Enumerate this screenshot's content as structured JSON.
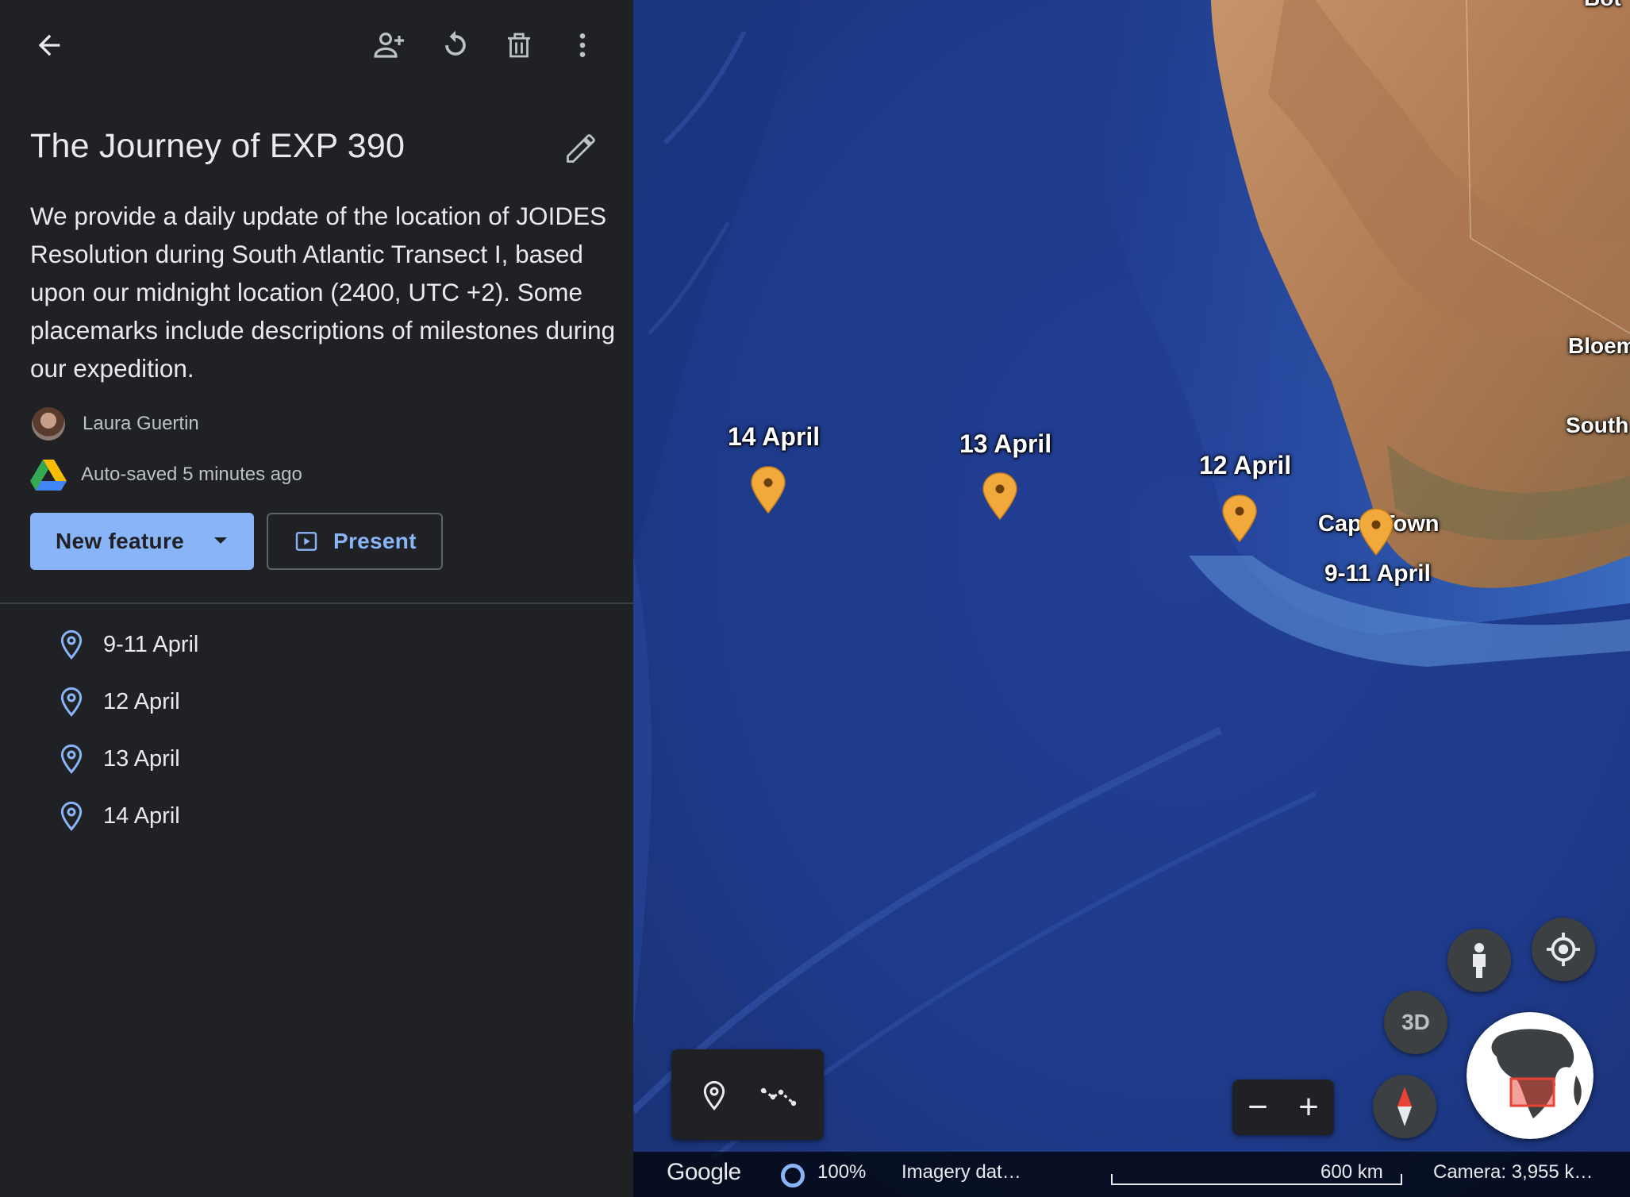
{
  "panel": {
    "title": "The Journey of EXP 390",
    "description": "We provide a daily update of the location of JOIDES Resolution during South Atlantic Transect I, based upon our midnight location (2400, UTC +2). Some placemarks include descriptions of milestones during our expedition.",
    "author": "Laura Guertin",
    "autosave": "Auto-saved 5 minutes ago",
    "new_feature_label": "New feature",
    "present_label": "Present",
    "features": [
      {
        "label": "9-11 April"
      },
      {
        "label": "12 April"
      },
      {
        "label": "13 April"
      },
      {
        "label": "14 April"
      }
    ]
  },
  "map": {
    "markers": [
      {
        "label": "14 April"
      },
      {
        "label": "13 April"
      },
      {
        "label": "12 April"
      },
      {
        "label": "9-11 April"
      }
    ],
    "place_labels": {
      "cape_town": "Cape Town",
      "bloemfontein": "Bloem",
      "south_africa": "South",
      "top_right": "Bot"
    },
    "btn_3d": "3D",
    "zoom_out": "−",
    "zoom_in": "+",
    "status": {
      "logo": "Google",
      "loading_percent": "100%",
      "imagery": "Imagery dat…",
      "scale": "600 km",
      "camera": "Camera: 3,955 k…"
    }
  },
  "colors": {
    "accent": "#8ab4f8",
    "marker": "#f2a93b",
    "panel_bg": "#202124",
    "ocean": "#1f3c8c",
    "land": "#b3825a"
  }
}
